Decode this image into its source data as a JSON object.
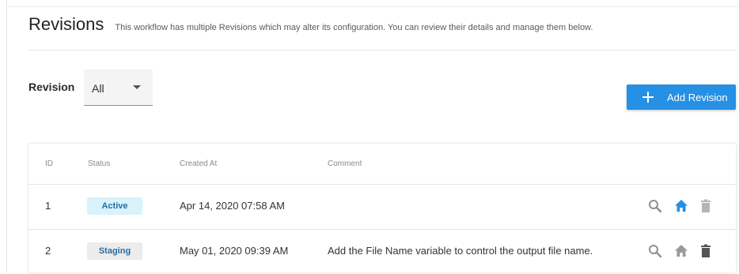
{
  "header": {
    "title": "Revisions",
    "subtitle": "This workflow has multiple Revisions which may alter its configuration. You can review their details and manage them below."
  },
  "filter": {
    "label": "Revision",
    "selected": "All"
  },
  "actions": {
    "add_label": "Add Revision"
  },
  "table": {
    "columns": [
      "ID",
      "Status",
      "Created At",
      "Comment"
    ],
    "rows": [
      {
        "id": "1",
        "status": "Active",
        "created_at": "Apr 14, 2020 07:58 AM",
        "comment": ""
      },
      {
        "id": "2",
        "status": "Staging",
        "created_at": "May 01, 2020 09:39 AM",
        "comment": "Add the File Name variable to control the output file name."
      }
    ]
  },
  "colors": {
    "accent": "#2590e4",
    "active_badge_bg": "#d9f2fb",
    "staging_badge_bg": "#ececec",
    "icon_gray": "#8f8f8f",
    "home_active": "#2590e4",
    "trash_dark": "#555555",
    "trash_light": "#9a9a9a"
  },
  "icons": {
    "add": "plus-icon",
    "view": "search-icon",
    "promote": "home-icon",
    "delete": "trash-icon",
    "dropdown": "caret-down-icon"
  }
}
